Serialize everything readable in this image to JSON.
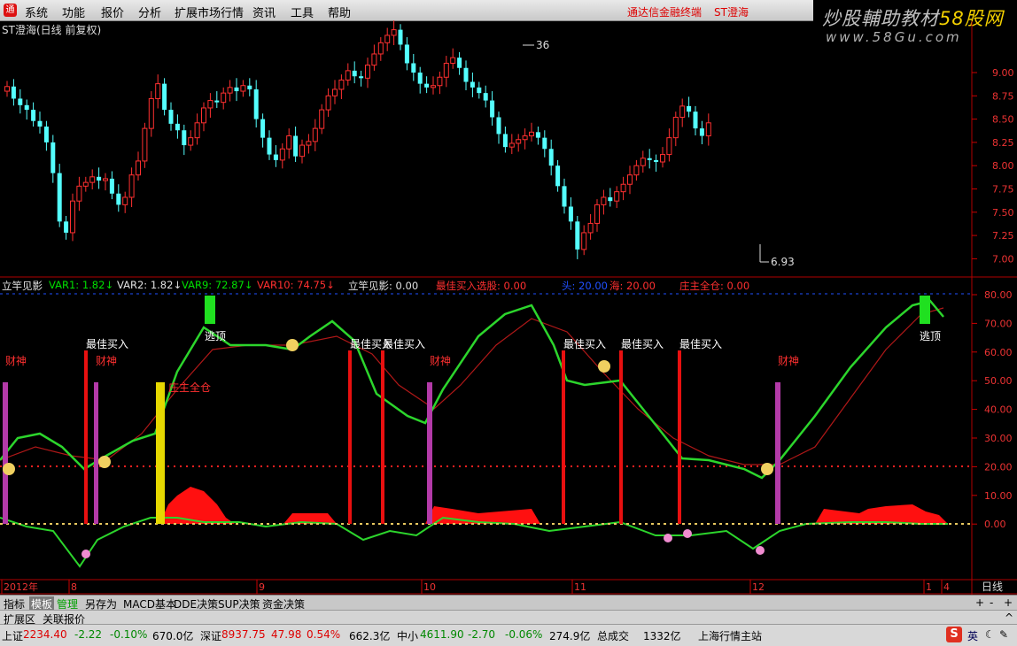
{
  "menubar": {
    "items": [
      "系统",
      "功能",
      "报价",
      "分析",
      "扩展市场行情",
      "资讯",
      "工具",
      "帮助"
    ],
    "promo1": "通达信金融终端",
    "promo2": "ST澄海"
  },
  "brand": {
    "line1_a": "炒股輔助教材",
    "line1_b": "58股网",
    "line2": "www.58Gu.com"
  },
  "stock_title": "ST澄海(日线 前复权)",
  "price_axis": [
    "9.00",
    "8.75",
    "8.50",
    "8.25",
    "8.00",
    "7.75",
    "7.50",
    "7.25",
    "7.00"
  ],
  "price_annotations": {
    "high": "36",
    "low": "6.93"
  },
  "indicator_labels": [
    {
      "text": "立竿见影",
      "color": "#e0e0e0"
    },
    {
      "text": "VAR1: 1.82↓",
      "color": "#00e000"
    },
    {
      "text": "VAR2: 1.82↓",
      "color": "#e0e0e0"
    },
    {
      "text": "VAR9: 72.87↓",
      "color": "#00e000"
    },
    {
      "text": "VAR10: 74.75↓",
      "color": "#ff3030"
    },
    {
      "text": "立竿见影: 0.00",
      "color": "#e0e0e0"
    },
    {
      "text": "最佳买入选股: 0.00",
      "color": "#ff3030"
    },
    {
      "text": "头: 20.00",
      "color": "#2050ff"
    },
    {
      "text": "海: 20.00",
      "color": "#ff3030"
    },
    {
      "text": "庄主全仓: 0.00",
      "color": "#ff3030"
    }
  ],
  "indicator_axis": [
    "80.00",
    "70.00",
    "60.00",
    "50.00",
    "40.00",
    "30.00",
    "20.00",
    "10.00",
    "0.00"
  ],
  "signals": {
    "best_buy": "最佳买入",
    "escape": "逃顶",
    "wealth_god": "财神",
    "zhuang_full": "庄主全仓"
  },
  "time_axis": [
    "2012年",
    "8",
    "9",
    "10",
    "11",
    "12",
    "1",
    "4"
  ],
  "period_label": "日线",
  "tabs": [
    "指标",
    "模板",
    "管理",
    "另存为",
    "MACD基本",
    "DDE决策",
    "SUP决策",
    "资金决策"
  ],
  "ext_tabs": [
    "扩展区",
    "关联报价"
  ],
  "status": {
    "sh_label": "上证",
    "sh_val": "2234.40",
    "sh_chg": "-2.22",
    "sh_pct": "-0.10%",
    "sh_amt": "670.0亿",
    "sz_label": "深证",
    "sz_val": "8937.75",
    "sz_chg": "47.98",
    "sz_pct": "0.54%",
    "sz_amt": "662.3亿",
    "zx_label": "中小",
    "zx_val": "4611.90",
    "zx_chg": "-2.70",
    "zx_pct": "-0.06%",
    "zx_amt": "274.9亿",
    "total_label": "总成交",
    "total_val": "1332亿",
    "server": "上海行情主站",
    "ime": "英"
  },
  "colors": {
    "up": "#ff3030",
    "down": "#54ffff",
    "green_line": "#2cd52c",
    "bg": "#000000"
  }
}
